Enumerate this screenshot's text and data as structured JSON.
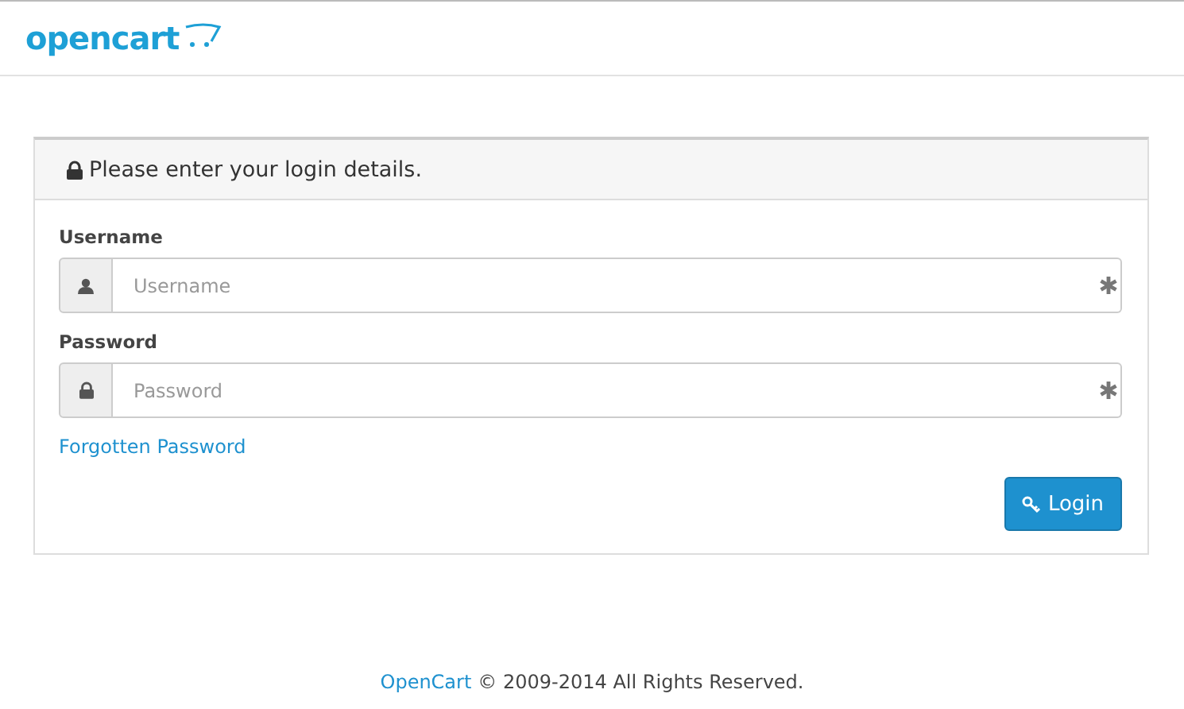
{
  "header": {
    "logo": "opencart"
  },
  "panel": {
    "title": "Please enter your login details."
  },
  "fields": [
    {
      "label": "Username",
      "placeholder": "Username",
      "kind": "user",
      "required": true
    },
    {
      "label": "Password",
      "placeholder": "Password",
      "kind": "lock",
      "required": true
    }
  ],
  "forgotten_link": "Forgotten Password",
  "login_button": "Login",
  "footer": {
    "link": "OpenCart",
    "text": "© 2009-2014 All Rights Reserved."
  }
}
